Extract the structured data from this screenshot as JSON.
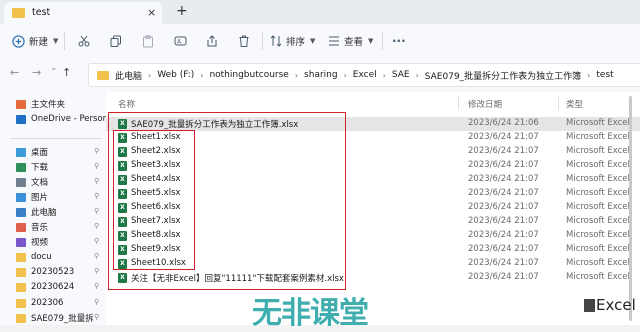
{
  "window": {
    "tab_title": "test",
    "close_glyph": "×",
    "new_tab_glyph": "+"
  },
  "toolbar": {
    "new_label": "新建",
    "sort_label": "排序",
    "view_label": "查看",
    "more_glyph": "···",
    "icons": [
      "plus-icon",
      "cut-icon",
      "copy-icon",
      "paste-icon",
      "rename-icon",
      "share-icon",
      "delete-icon",
      "sort-icon",
      "view-icon",
      "more-icon"
    ]
  },
  "nav": {
    "back": "←",
    "forward": "→",
    "up_chevron": "⌄",
    "up": "↑",
    "refresh": "↻"
  },
  "breadcrumbs": [
    "此电脑",
    "Web (F:)",
    "nothingbutcourse",
    "sharing",
    "Excel",
    "SAE",
    "SAE079_批量拆分工作表为独立工作簿",
    "test"
  ],
  "breadcrumb_sep": "›",
  "sidebar": {
    "items": [
      {
        "label": "主文件夹",
        "icon": "home-icon",
        "color": "#e56b3b",
        "pinned": false
      },
      {
        "label": "OneDrive - Person",
        "icon": "cloud-icon",
        "color": "#1f6fc5",
        "pinned": false
      },
      {
        "label": "桌面",
        "icon": "desktop-icon",
        "color": "#3a9bd9",
        "pinned": true
      },
      {
        "label": "下载",
        "icon": "download-icon",
        "color": "#2f8f5b",
        "pinned": true
      },
      {
        "label": "文档",
        "icon": "document-icon",
        "color": "#6f7f90",
        "pinned": true
      },
      {
        "label": "图片",
        "icon": "picture-icon",
        "color": "#3a8fd6",
        "pinned": true
      },
      {
        "label": "此电脑",
        "icon": "computer-icon",
        "color": "#3a7fc8",
        "pinned": true
      },
      {
        "label": "音乐",
        "icon": "music-icon",
        "color": "#e0604d",
        "pinned": true
      },
      {
        "label": "视频",
        "icon": "video-icon",
        "color": "#7a57c8",
        "pinned": true
      },
      {
        "label": "docu",
        "icon": "folder-icon",
        "color": "#f2c14b",
        "pinned": true
      },
      {
        "label": "20230523",
        "icon": "folder-icon",
        "color": "#f2c14b",
        "pinned": true
      },
      {
        "label": "20230624",
        "icon": "folder-icon",
        "color": "#f2c14b",
        "pinned": true
      },
      {
        "label": "202306",
        "icon": "folder-icon",
        "color": "#f2c14b",
        "pinned": true
      },
      {
        "label": "SAE079_批量拆",
        "icon": "folder-icon",
        "color": "#f2c14b",
        "pinned": true
      }
    ],
    "pin_glyph": "📌"
  },
  "columns": {
    "name": "名称",
    "date": "修改日期",
    "type": "类型"
  },
  "files": [
    {
      "name": "SAE079_批量拆分工作表为独立工作簿.xlsx",
      "date": "2023/6/24 21:06",
      "type": "Microsoft Excel",
      "selected": true
    },
    {
      "name": "Sheet1.xlsx",
      "date": "2023/6/24 21:07",
      "type": "Microsoft Excel",
      "selected": false
    },
    {
      "name": "Sheet2.xlsx",
      "date": "2023/6/24 21:07",
      "type": "Microsoft Excel",
      "selected": false
    },
    {
      "name": "Sheet3.xlsx",
      "date": "2023/6/24 21:07",
      "type": "Microsoft Excel",
      "selected": false
    },
    {
      "name": "Sheet4.xlsx",
      "date": "2023/6/24 21:07",
      "type": "Microsoft Excel",
      "selected": false
    },
    {
      "name": "Sheet5.xlsx",
      "date": "2023/6/24 21:07",
      "type": "Microsoft Excel",
      "selected": false
    },
    {
      "name": "Sheet6.xlsx",
      "date": "2023/6/24 21:07",
      "type": "Microsoft Excel",
      "selected": false
    },
    {
      "name": "Sheet7.xlsx",
      "date": "2023/6/24 21:07",
      "type": "Microsoft Excel",
      "selected": false
    },
    {
      "name": "Sheet8.xlsx",
      "date": "2023/6/24 21:07",
      "type": "Microsoft Excel",
      "selected": false
    },
    {
      "name": "Sheet9.xlsx",
      "date": "2023/6/24 21:07",
      "type": "Microsoft Excel",
      "selected": false
    },
    {
      "name": "Sheet10.xlsx",
      "date": "2023/6/24 21:07",
      "type": "Microsoft Excel",
      "selected": false
    },
    {
      "name": "关注【无非Excel】回复\"11111\"下载配套案例素材.xlsx",
      "date": "2023/6/24 21:07",
      "type": "Microsoft Excel",
      "selected": false
    }
  ],
  "file_icon_letter": "X",
  "watermark": {
    "logo_text": "无非课堂",
    "brand": "Excel",
    "color": "#1fa0a0"
  },
  "colors": {
    "highlight_box": "#d0222a",
    "excel_green": "#1d7a45",
    "folder_yellow": "#f2c14b"
  }
}
